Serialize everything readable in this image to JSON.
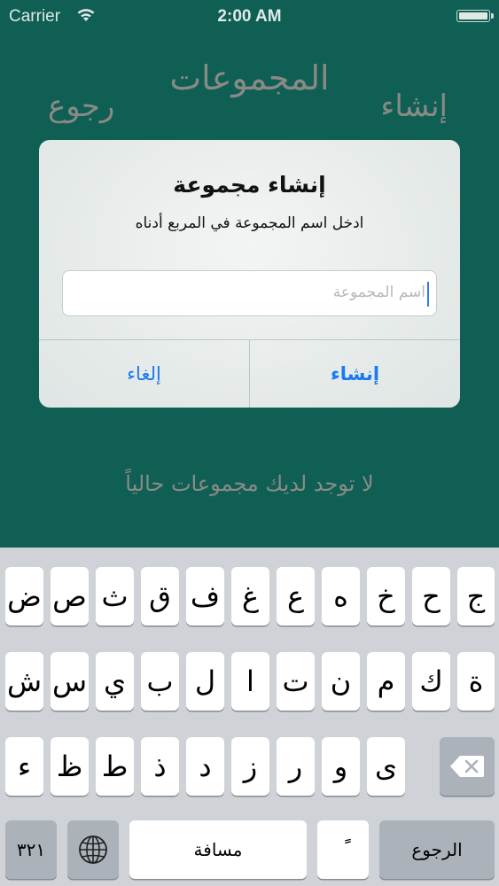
{
  "status_bar": {
    "carrier": "Carrier",
    "time": "2:00 AM",
    "wifi_icon": "wifi-icon",
    "battery_icon": "battery-icon"
  },
  "nav": {
    "title": "المجموعات",
    "left": "رجوع",
    "right": "إنشاء"
  },
  "empty_message": "لا توجد لديك مجموعات حالياً",
  "alert": {
    "title": "إنشاء مجموعة",
    "message": "ادخل اسم المجموعة في المربع أدناه",
    "input_value": "",
    "input_placeholder": "اسم المجموعة",
    "cancel_label": "إلغاء",
    "create_label": "إنشاء",
    "accent": "#1a7af2"
  },
  "keyboard": {
    "row1": [
      "ض",
      "ص",
      "ث",
      "ق",
      "ف",
      "غ",
      "ع",
      "ه",
      "خ",
      "ح",
      "ج"
    ],
    "row2": [
      "ش",
      "س",
      "ي",
      "ب",
      "ل",
      "ا",
      "ت",
      "ن",
      "م",
      "ك",
      "ة"
    ],
    "row3": [
      "ء",
      "ظ",
      "ط",
      "ذ",
      "د",
      "ز",
      "ر",
      "و",
      "ى"
    ],
    "numbers_label": "٣٢١",
    "globe_icon": "globe-icon",
    "space_label": "مسافة",
    "diacritic_label": "ًً",
    "return_label": "الرجوع",
    "delete_icon": "backspace-icon"
  }
}
